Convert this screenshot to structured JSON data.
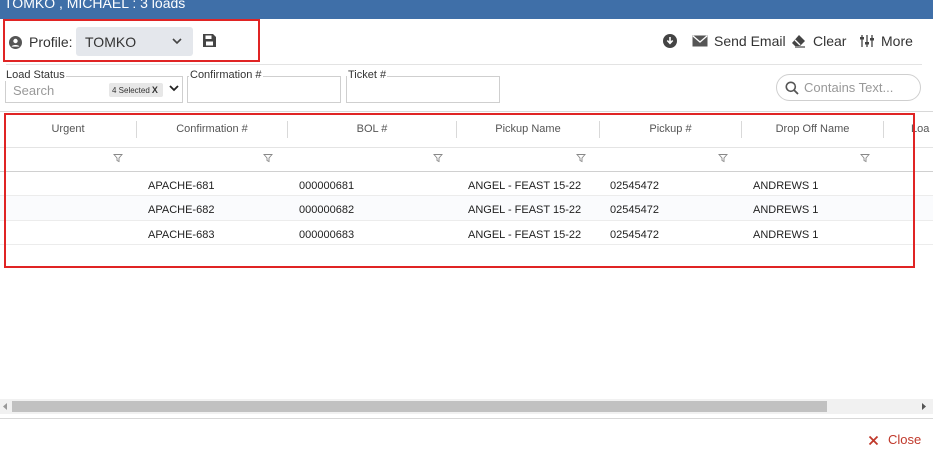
{
  "window": {
    "title": "TOMKO , MICHAEL : 3 loads"
  },
  "toolbar": {
    "profile_label": "Profile:",
    "profile_value": "TOMKO",
    "send_email_label": "Send Email",
    "clear_label": "Clear",
    "more_label": "More"
  },
  "filters": {
    "load_status_label": "Load Status",
    "load_status_placeholder": "Search",
    "load_status_chip": "4 Selected",
    "load_status_chip_remove": "X",
    "confirmation_label": "Confirmation #",
    "ticket_label": "Ticket #",
    "contains_text_placeholder": "Contains Text..."
  },
  "grid": {
    "columns": [
      "Urgent",
      "Confirmation #",
      "BOL #",
      "Pickup Name",
      "Pickup #",
      "Drop Off Name",
      "Loa"
    ],
    "rows": [
      {
        "confirmation": "APACHE-681",
        "bol": "000000681",
        "pickup_name": "ANGEL - FEAST 15-22",
        "pickup_no": "02545472",
        "drop_off": "ANDREWS 1"
      },
      {
        "confirmation": "APACHE-682",
        "bol": "000000682",
        "pickup_name": "ANGEL - FEAST 15-22",
        "pickup_no": "02545472",
        "drop_off": "ANDREWS 1"
      },
      {
        "confirmation": "APACHE-683",
        "bol": "000000683",
        "pickup_name": "ANGEL - FEAST 15-22",
        "pickup_no": "02545472",
        "drop_off": "ANDREWS 1"
      }
    ]
  },
  "footer": {
    "close_label": "Close"
  },
  "colors": {
    "title_bar": "#3f6fa8",
    "highlight": "#e02424",
    "close": "#c0392b"
  },
  "icons": [
    "user-circle-icon",
    "chevron-down-icon",
    "save-icon",
    "download-icon",
    "envelope-icon",
    "eraser-icon",
    "sliders-icon",
    "search-icon",
    "funnel-icon",
    "close-icon"
  ]
}
